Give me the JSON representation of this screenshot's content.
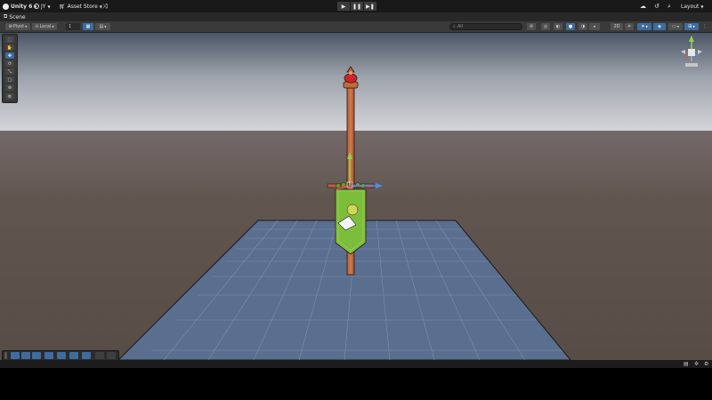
{
  "topbar": {
    "app_title": "Unity 6",
    "account": "JY",
    "asset_store": "Asset Store",
    "layout": "Layout"
  },
  "icons": [
    "unity-logo-icon",
    "account-icon",
    "cart-icon",
    "version-control-icon",
    "play-icon",
    "pause-icon",
    "step-icon",
    "cloud-icon",
    "history-icon",
    "search-icon",
    "settings-icon",
    "scene-icon",
    "hand-icon",
    "move-icon",
    "rotate-icon",
    "scale-icon",
    "rect-icon",
    "transform-icon",
    "custom-tool-icon",
    "orientation-gizmo-icon"
  ],
  "scene_tab": {
    "label": "Scene"
  },
  "scene_toolbar": {
    "pivot": "Pivot",
    "space": "Local",
    "grid_size": "1",
    "search_placeholder": "All",
    "mode_2d": "2D"
  },
  "colors": {
    "accent": "#3e6c9e",
    "ground": "#61564f",
    "sky": "#d0d3d8",
    "plane": "#5a6e8f",
    "banner": "#7cbd3c"
  }
}
